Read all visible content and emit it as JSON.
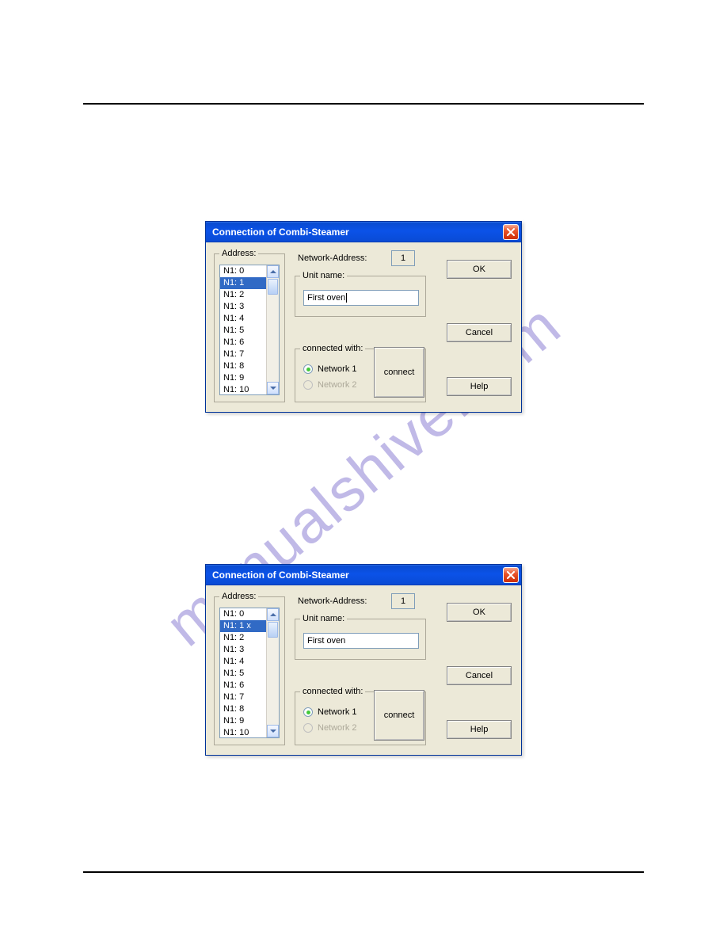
{
  "watermark": "manualshive.com",
  "dialog1": {
    "title": "Connection of Combi-Steamer",
    "address_legend": "Address:",
    "address_items": [
      "N1:  0",
      "N1:  1",
      "N1:  2",
      "N1:  3",
      "N1:  4",
      "N1:  5",
      "N1:  6",
      "N1:  7",
      "N1:  8",
      "N1:  9",
      "N1: 10"
    ],
    "selected_index": 1,
    "network_address_label": "Network-Address:",
    "network_address_value": "1",
    "unit_name_legend": "Unit name:",
    "unit_name_value": "First oven",
    "show_caret": true,
    "connected_legend": "connected with:",
    "radio1": "Network 1",
    "radio2": "Network 2",
    "radio_selected": 1,
    "connect_label": "connect",
    "ok_label": "OK",
    "cancel_label": "Cancel",
    "help_label": "Help"
  },
  "dialog2": {
    "title": "Connection of Combi-Steamer",
    "address_legend": "Address:",
    "address_items": [
      "N1:  0",
      "N1:  1 x",
      "N1:  2",
      "N1:  3",
      "N1:  4",
      "N1:  5",
      "N1:  6",
      "N1:  7",
      "N1:  8",
      "N1:  9",
      "N1: 10"
    ],
    "selected_index": 1,
    "network_address_label": "Network-Address:",
    "network_address_value": "1",
    "unit_name_legend": "Unit name:",
    "unit_name_value": "First oven",
    "show_caret": false,
    "connected_legend": "connected with:",
    "radio1": "Network 1",
    "radio2": "Network 2",
    "radio_selected": 1,
    "connect_label": "connect",
    "ok_label": "OK",
    "cancel_label": "Cancel",
    "help_label": "Help"
  }
}
